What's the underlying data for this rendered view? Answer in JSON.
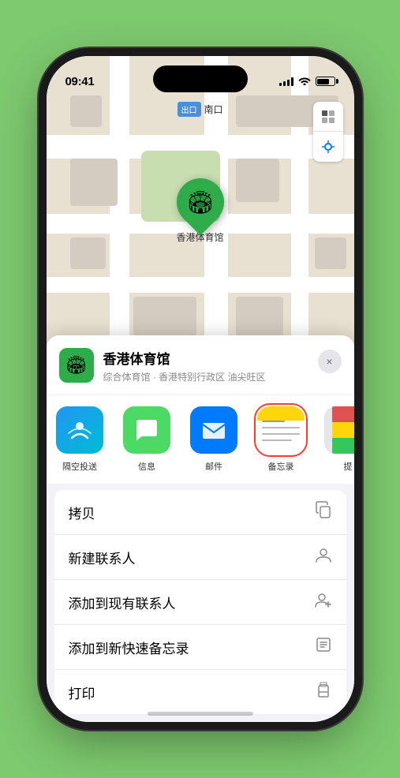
{
  "phone": {
    "status_bar": {
      "time": "09:41",
      "location_arrow": "▲"
    },
    "map": {
      "label_tag": "出口",
      "label_text": "南口",
      "venue_name_on_map": "香港体育馆",
      "controls": [
        "map-view-icon",
        "location-icon"
      ]
    },
    "bottom_sheet": {
      "venue_icon": "🏟",
      "venue_name": "香港体育馆",
      "venue_subtitle": "综合体育馆 · 香港特别行政区 油尖旺区",
      "close_label": "×",
      "share_items": [
        {
          "id": "airdrop",
          "label": "隔空投送",
          "highlighted": false
        },
        {
          "id": "message",
          "label": "信息",
          "highlighted": false
        },
        {
          "id": "mail",
          "label": "邮件",
          "highlighted": false
        },
        {
          "id": "notes",
          "label": "备忘录",
          "highlighted": true
        },
        {
          "id": "more",
          "label": "提",
          "highlighted": false
        }
      ],
      "action_items": [
        {
          "id": "copy",
          "label": "拷贝",
          "icon": "⎘"
        },
        {
          "id": "new-contact",
          "label": "新建联系人",
          "icon": "👤"
        },
        {
          "id": "add-existing",
          "label": "添加到现有联系人",
          "icon": "👤"
        },
        {
          "id": "add-note",
          "label": "添加到新快速备忘录",
          "icon": "🗒"
        },
        {
          "id": "print",
          "label": "打印",
          "icon": "🖨"
        }
      ]
    }
  }
}
